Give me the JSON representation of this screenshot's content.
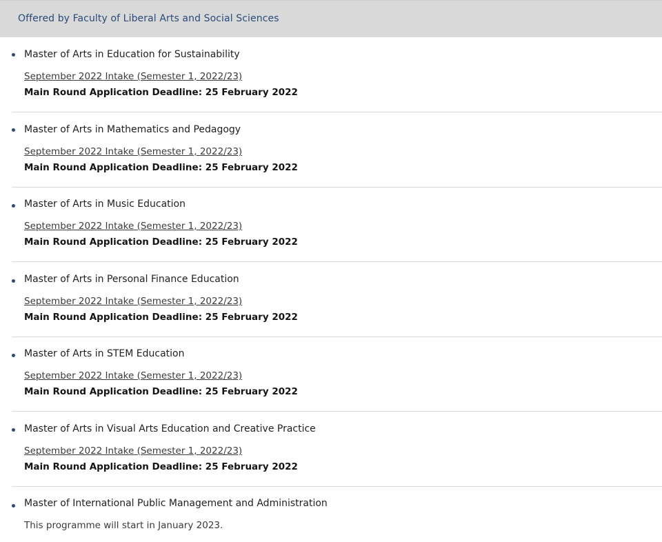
{
  "header": {
    "title": "Offered by Faculty of Liberal Arts and Social Sciences"
  },
  "programmes": [
    {
      "title": "Master of Arts in Education for Sustainability",
      "intake": "September 2022 Intake (Semester 1, 2022/23)",
      "deadline": "Main Round Application Deadline: 25 February 2022"
    },
    {
      "title": "Master of Arts in Mathematics and Pedagogy",
      "intake": "September 2022 Intake (Semester 1, 2022/23)",
      "deadline": "Main Round Application Deadline: 25 February 2022"
    },
    {
      "title": "Master of Arts in Music Education",
      "intake": "September 2022 Intake (Semester 1, 2022/23)",
      "deadline": "Main Round Application Deadline: 25 February 2022"
    },
    {
      "title": "Master of Arts in Personal Finance Education",
      "intake": "September 2022 Intake (Semester 1, 2022/23)",
      "deadline": "Main Round Application Deadline: 25 February 2022"
    },
    {
      "title": "Master of Arts in STEM Education",
      "intake": "September 2022 Intake (Semester 1, 2022/23)",
      "deadline": "Main Round Application Deadline: 25 February 2022"
    },
    {
      "title": "Master of Arts in Visual Arts Education and Creative Practice",
      "intake": "September 2022 Intake (Semester 1, 2022/23)",
      "deadline": "Main Round Application Deadline: 25 February 2022"
    },
    {
      "title": "Master of International Public Management and Administration",
      "note": "This programme will start in January 2023."
    }
  ]
}
